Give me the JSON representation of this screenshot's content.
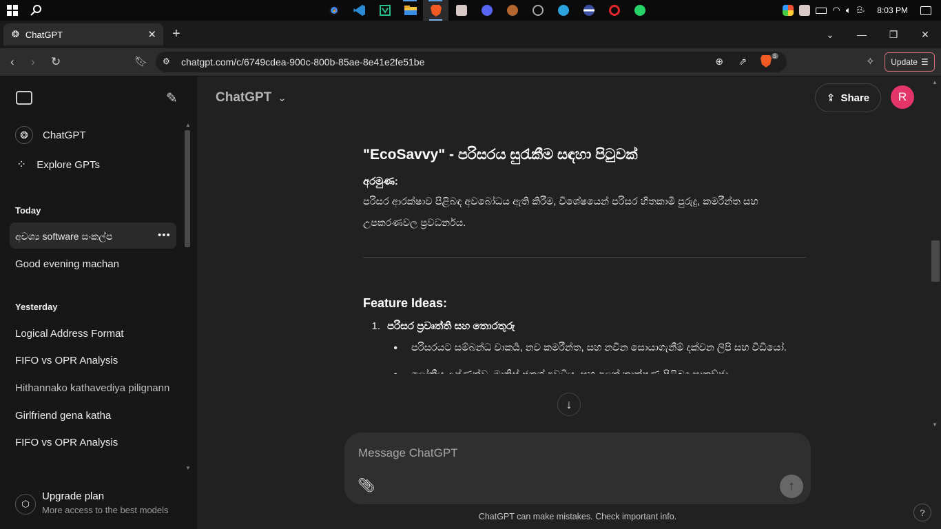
{
  "taskbar": {
    "time": "8:03 PM",
    "lang": "සිං",
    "apps": [
      "chrome",
      "vscode",
      "app-vs",
      "file-explorer",
      "brave",
      "app-avatar",
      "discord",
      "app-orange",
      "app-circle",
      "telegram",
      "app-ball",
      "app-red",
      "whatsapp"
    ]
  },
  "browser": {
    "tab_title": "ChatGPT",
    "url": "chatgpt.com/c/6749cdea-900c-800b-85ae-8e41e2fe51be",
    "update_label": "Update",
    "shield_count": "5"
  },
  "sidebar": {
    "chatgpt_label": "ChatGPT",
    "explore_label": "Explore GPTs",
    "today_heading": "Today",
    "today_chats": [
      "අවශ්‍ය software සංකල්ප",
      "Good evening machan"
    ],
    "yesterday_heading": "Yesterday",
    "yesterday_chats": [
      "Logical Address Format",
      "FIFO vs OPR Analysis",
      "Hithannako kathavediya pilignann",
      "Girlfriend gena katha",
      "FIFO vs OPR Analysis"
    ],
    "upgrade_title": "Upgrade plan",
    "upgrade_sub": "More access to the best models"
  },
  "main": {
    "model_label": "ChatGPT",
    "share_label": "Share",
    "avatar_letter": "R",
    "heading": "\"EcoSavvy\" - පරිසරය සුරැකීම සඳහා පිටුවක්",
    "aim_label": "අරමුණ:",
    "aim_text": "පරිසර ආරක්ෂාව පිළිබඳ අවබෝධය ඇති කිරීම, විශේෂයෙන් පරිසර හිතකාමී පුරුදු, කමරීන්ත සහ උපකරණවල ප්‍රවධර්නය.",
    "feature_heading": "Feature Ideas:",
    "feature_1": "පරිසර ප්‍රවෘත්ති සහ තොරතුරු",
    "bullet_1": "පරිසරයට සම්බන්ධ වාකර්‍ය, නව කමරීන්ත, සහ නවීන සොයාගැනීම් දක්වන ලිපි සහ වීඩියෝ.",
    "bullet_2_partial": "ලෝකීය උෂ්ණත්ව, මානිස් ජනග් අවධිය, සහ අලත් තාක්ෂණ පිළිබඳ සාකච්ඡා",
    "composer_placeholder": "Message ChatGPT",
    "disclaimer": "ChatGPT can make mistakes. Check important info.",
    "help_label": "?"
  }
}
